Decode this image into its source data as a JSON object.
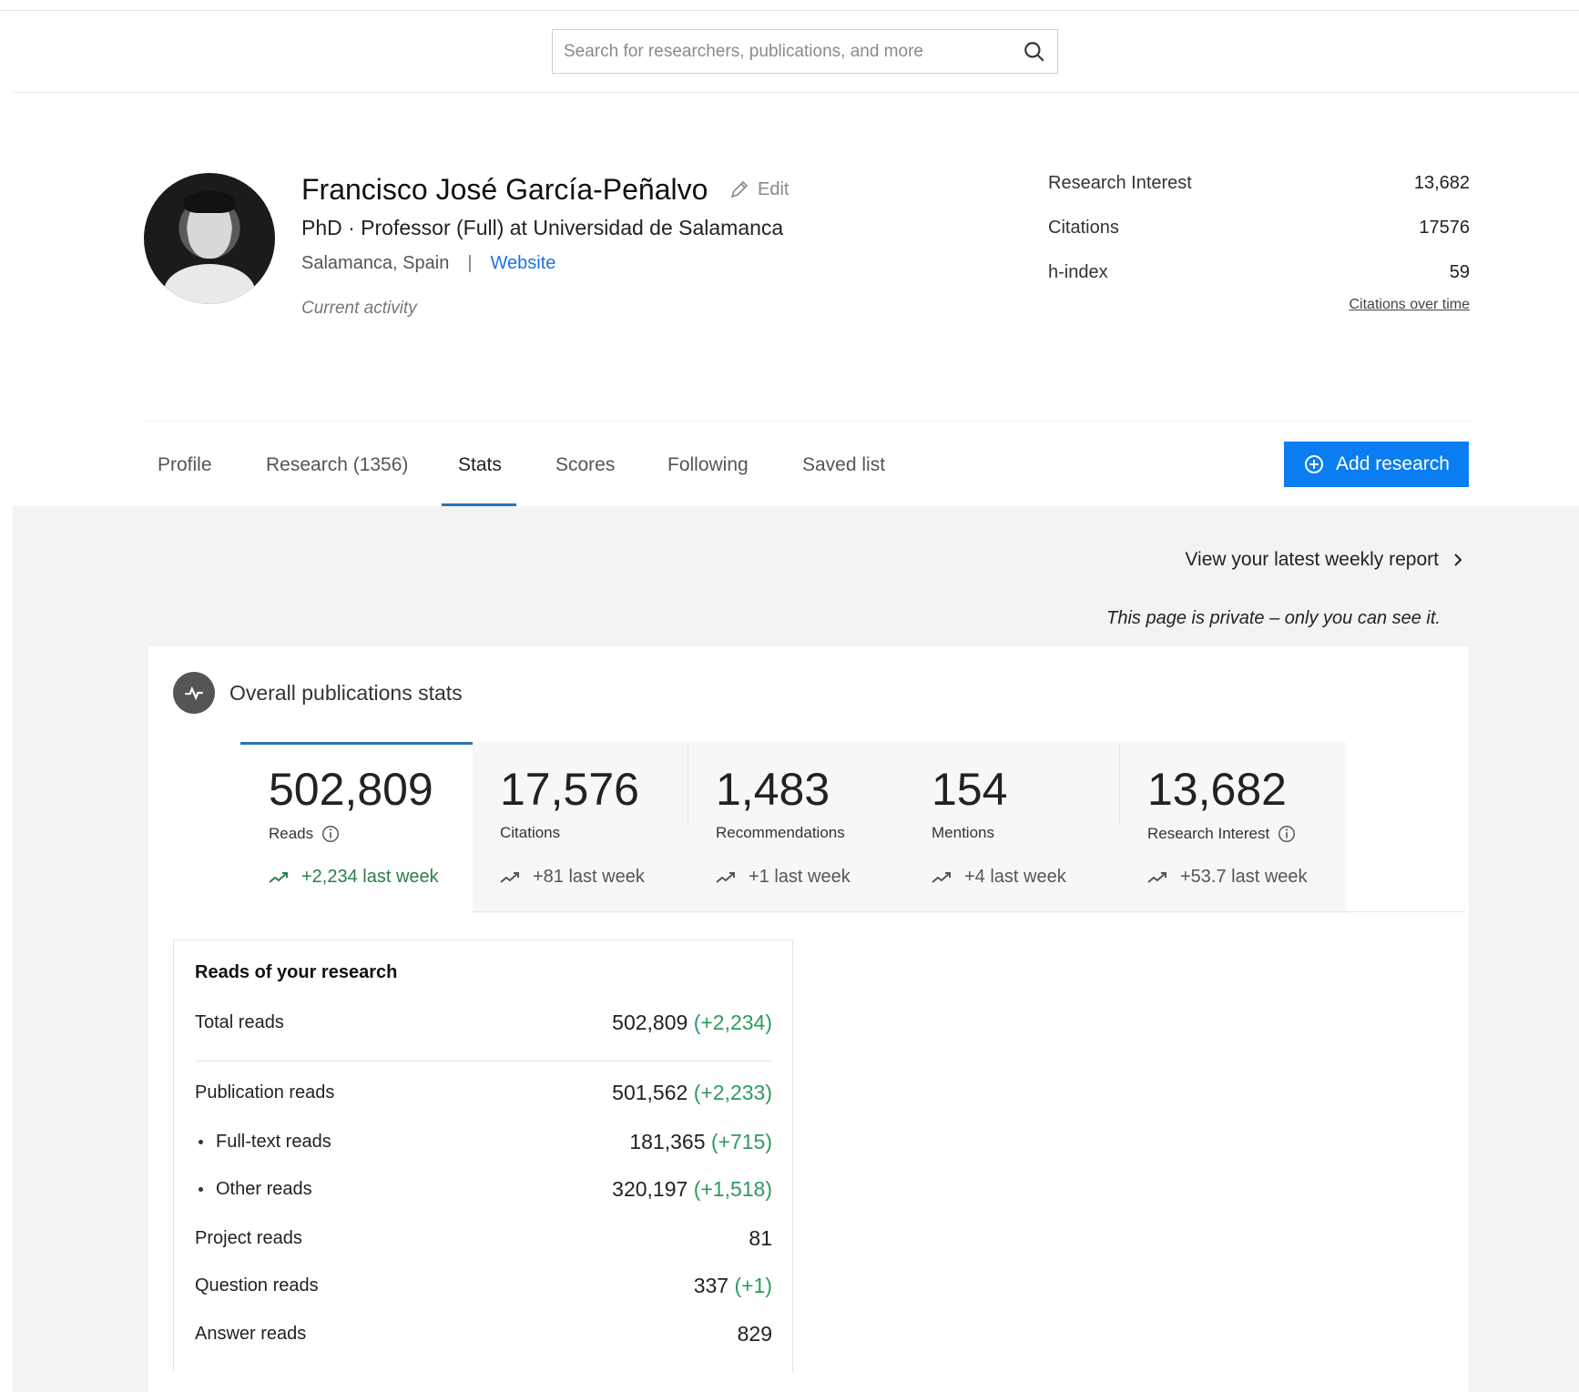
{
  "search": {
    "placeholder": "Search for researchers, publications, and more"
  },
  "profile": {
    "name": "Francisco José García-Peñalvo",
    "edit_label": "Edit",
    "title": "PhD · Professor (Full) at Universidad de Salamanca",
    "location": "Salamanca, Spain",
    "separator": "|",
    "website_label": "Website",
    "current_activity": "Current activity"
  },
  "metrics": {
    "items": [
      {
        "label": "Research Interest",
        "value": "13,682"
      },
      {
        "label": "Citations",
        "value": "17576"
      },
      {
        "label": "h-index",
        "value": "59"
      }
    ],
    "citations_over_time": "Citations over time"
  },
  "tabs": [
    {
      "label": "Profile"
    },
    {
      "label": "Research (1356)"
    },
    {
      "label": "Stats",
      "active": true
    },
    {
      "label": "Scores"
    },
    {
      "label": "Following"
    },
    {
      "label": "Saved list"
    }
  ],
  "add_research_label": "Add research",
  "weekly_report_label": "View your latest weekly report",
  "private_note": "This page is private – only you can see it.",
  "overall_stats": {
    "title": "Overall publications stats",
    "items": [
      {
        "value": "502,809",
        "label": "Reads",
        "trend": "+2,234 last week"
      },
      {
        "value": "17,576",
        "label": "Citations",
        "trend": "+81 last week"
      },
      {
        "value": "1,483",
        "label": "Recommendations",
        "trend": "+1 last week"
      },
      {
        "value": "154",
        "label": "Mentions",
        "trend": "+4 last week"
      },
      {
        "value": "13,682",
        "label": "Research Interest",
        "trend": "+53.7 last week"
      }
    ]
  },
  "reads": {
    "title": "Reads of your research",
    "rows": [
      {
        "label": "Total reads",
        "value": "502,809",
        "delta": "(+2,234)"
      },
      {
        "label": "Publication reads",
        "value": "501,562",
        "delta": "(+2,233)"
      },
      {
        "label": "Full-text reads",
        "value": "181,365",
        "delta": "(+715)"
      },
      {
        "label": "Other reads",
        "value": "320,197",
        "delta": "(+1,518)"
      },
      {
        "label": "Project reads",
        "value": "81",
        "delta": ""
      },
      {
        "label": "Question reads",
        "value": "337",
        "delta": "(+1)"
      },
      {
        "label": "Answer reads",
        "value": "829",
        "delta": ""
      }
    ]
  },
  "colors": {
    "accent": "#0a7df2",
    "tab_underline": "#2b72b3",
    "positive": "#2e9a5d",
    "link": "#1a73e8"
  }
}
